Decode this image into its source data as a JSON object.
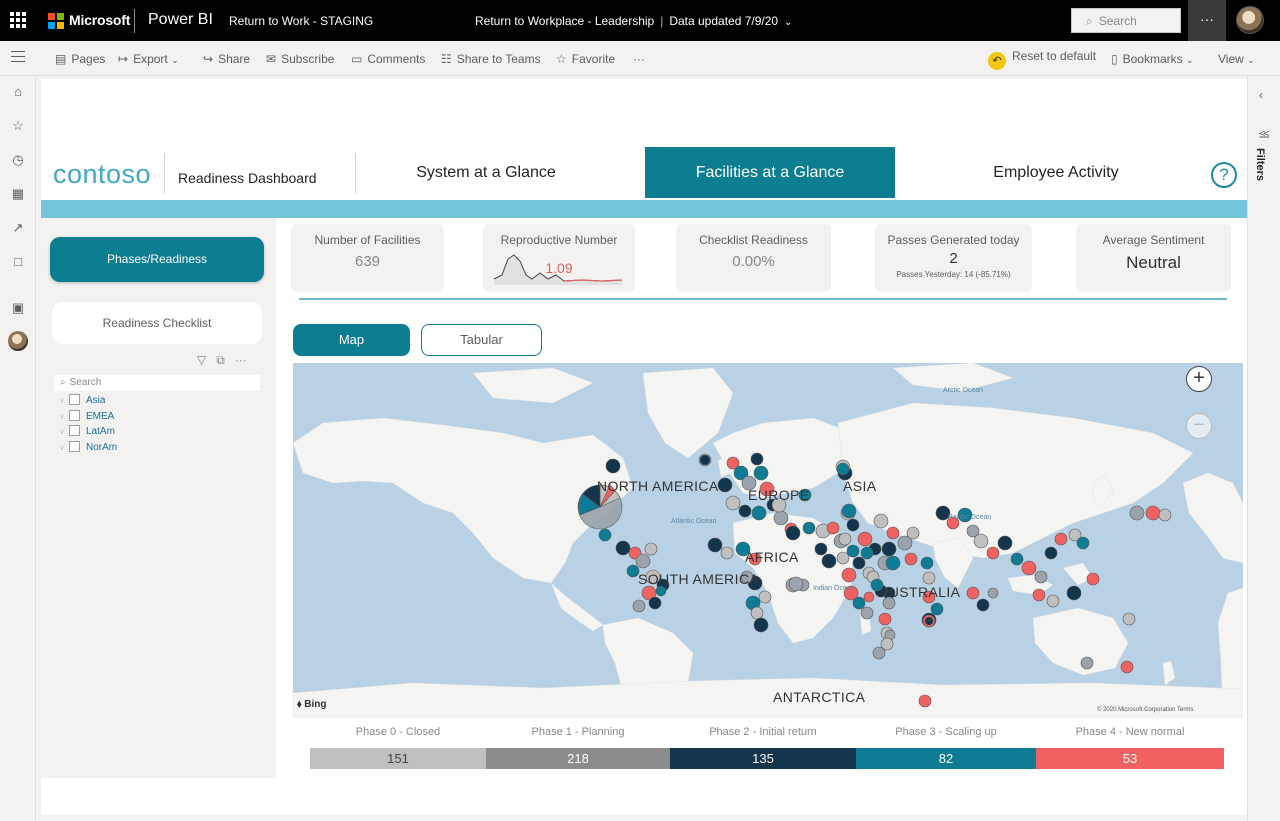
{
  "topbar": {
    "brand": "Microsoft",
    "product": "Power BI",
    "workspace": "Return to Work - STAGING",
    "report": "Return to Workplace - Leadership",
    "data_updated": "Data updated 7/9/20",
    "search_placeholder": "Search",
    "more": "···"
  },
  "actions": {
    "pages": "Pages",
    "export": "Export",
    "share": "Share",
    "subscribe": "Subscribe",
    "comments": "Comments",
    "share_teams": "Share to Teams",
    "favorite": "Favorite",
    "more": "···",
    "reset": "Reset to default",
    "bookmarks": "Bookmarks",
    "view": "View"
  },
  "filters_pane": {
    "label": "Filters"
  },
  "header": {
    "logo": "contoso",
    "dashboard_title": "Readiness Dashboard",
    "tabs": [
      {
        "label": "System at a Glance"
      },
      {
        "label": "Facilities at a Glance"
      },
      {
        "label": "Employee Activity"
      }
    ],
    "help": "?"
  },
  "left_panel": {
    "phases_button": "Phases/Readiness",
    "checklist_button": "Readiness Checklist",
    "search_placeholder": "Search",
    "regions": [
      "Asia",
      "EMEA",
      "LatAm",
      "NorAm"
    ]
  },
  "kpis": {
    "facilities": {
      "label": "Number of Facilities",
      "value": "639"
    },
    "reproductive": {
      "label": "Reproductive Number",
      "value": "1.09"
    },
    "checklist": {
      "label": "Checklist Readiness",
      "value": "0.00%"
    },
    "passes": {
      "label": "Passes Generated today",
      "value": "2",
      "sub": "Passes Yesterday: 14 (-85.71%)"
    },
    "sentiment": {
      "label": "Average Sentiment",
      "value": "Neutral"
    }
  },
  "view_toggle": {
    "map": "Map",
    "tabular": "Tabular"
  },
  "map": {
    "continents": [
      "NORTH AMERICA",
      "EUROPE",
      "ASIA",
      "AFRICA",
      "SOUTH AMERICA",
      "AUSTRALIA",
      "ANTARCTICA"
    ],
    "oceans": [
      "Arctic Ocean",
      "Atlantic Ocean",
      "Pacific Ocean",
      "Indian Ocean"
    ],
    "attribution": "Bing",
    "copyright": "© 2020 Microsoft Corporation  Terms",
    "zoom_in": "+",
    "zoom_out": "−"
  },
  "phases": [
    {
      "label": "Phase 0 - Closed",
      "count": "151",
      "color": "#bfbfbf"
    },
    {
      "label": "Phase 1 - Planning",
      "count": "218",
      "color": "#8c8c8c"
    },
    {
      "label": "Phase 2 - Initial return",
      "count": "135",
      "color": "#14364d"
    },
    {
      "label": "Phase 3 - Scaling up",
      "count": "82",
      "color": "#0e7c94"
    },
    {
      "label": "Phase 4 - New normal",
      "count": "53",
      "color": "#f06262"
    }
  ],
  "colors": {
    "accent": "#0d7d91",
    "band": "#73c4d8",
    "ocean": "#b9d1e5",
    "land": "#f4f4f2"
  }
}
